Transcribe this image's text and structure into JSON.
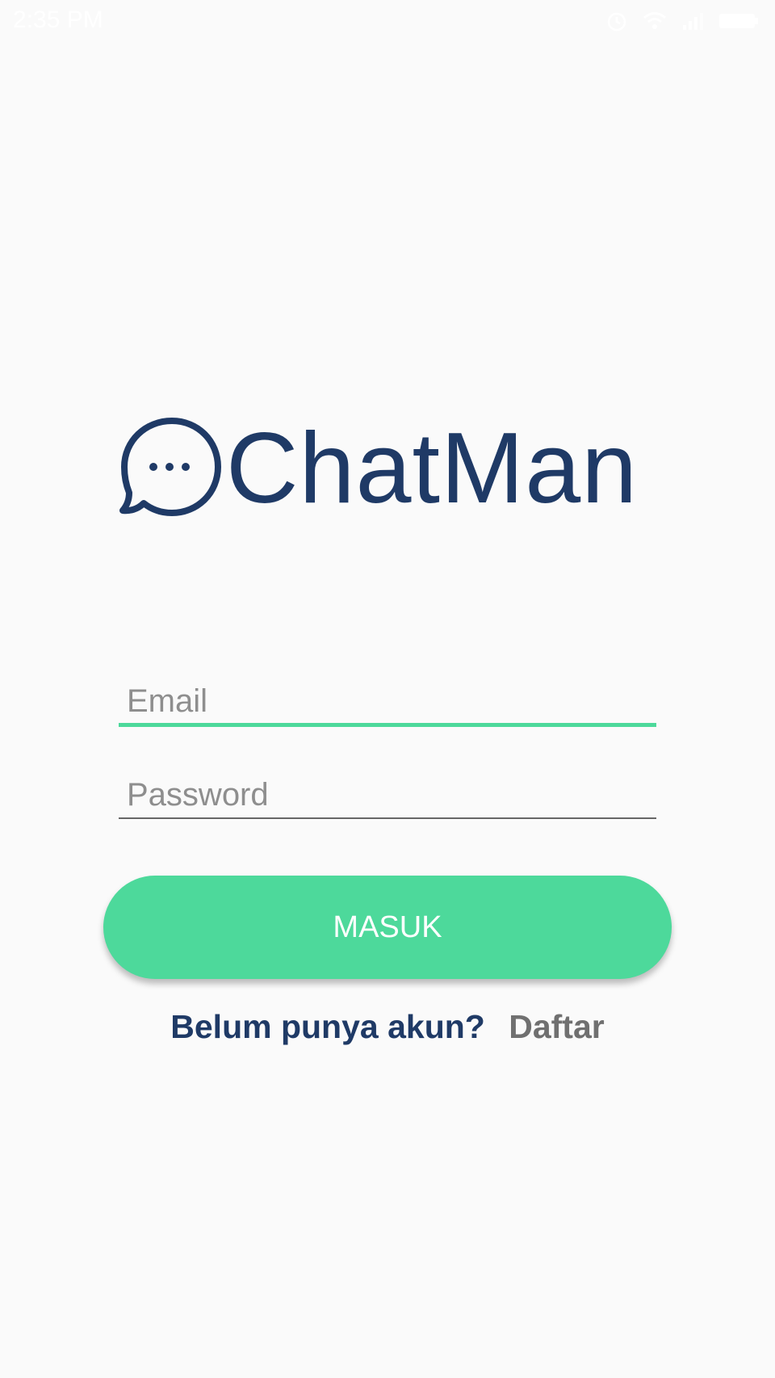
{
  "status_bar": {
    "time": "2:35 PM",
    "icons": [
      "alarm-icon",
      "wifi-icon",
      "signal-icon",
      "battery-icon"
    ]
  },
  "logo": {
    "icon": "chat-bubble-icon",
    "text": "ChatMan",
    "color": "#1f3a66"
  },
  "form": {
    "email_placeholder": "Email",
    "email_value": "",
    "password_placeholder": "Password",
    "password_value": "",
    "submit_label": "MASUK",
    "accent_color": "#4dd99b"
  },
  "register": {
    "question": "Belum punya akun?",
    "link_label": "Daftar"
  }
}
